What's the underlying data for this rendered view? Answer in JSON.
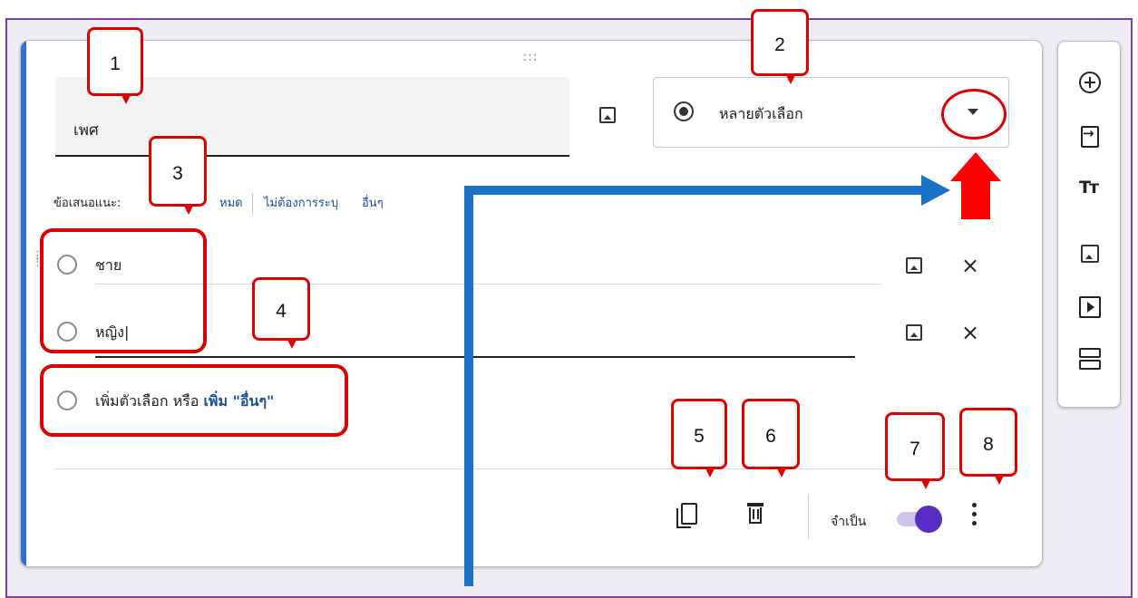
{
  "question": {
    "title": "เพศ",
    "drag_handle": ":::"
  },
  "type_selector": {
    "label": "หลายตัวเลือก",
    "caret_icon": "chevron-down-icon"
  },
  "suggestions": {
    "prefix": "ข้อเสนอแนะ:",
    "item_all": "หมด",
    "item_no_answer": "ไม่ต้องการระบุ",
    "item_other": "อื่นๆ"
  },
  "options": [
    {
      "label": "ชาย"
    },
    {
      "label": "หญิง|"
    }
  ],
  "add_option": {
    "text": "เพิ่มตัวเลือก หรือ",
    "link": "เพิ่ม \"อื่นๆ\""
  },
  "footer": {
    "required_label": "จำเป็น",
    "required_on": true,
    "more_icon": "more-vert-icon"
  },
  "callouts": [
    "1",
    "2",
    "3",
    "4",
    "5",
    "6",
    "7",
    "8"
  ],
  "colors": {
    "accent": "#2f6fd0",
    "annotation": "#e00000",
    "toggle": "#5a2cc4",
    "arrow": "#1a73c8"
  }
}
